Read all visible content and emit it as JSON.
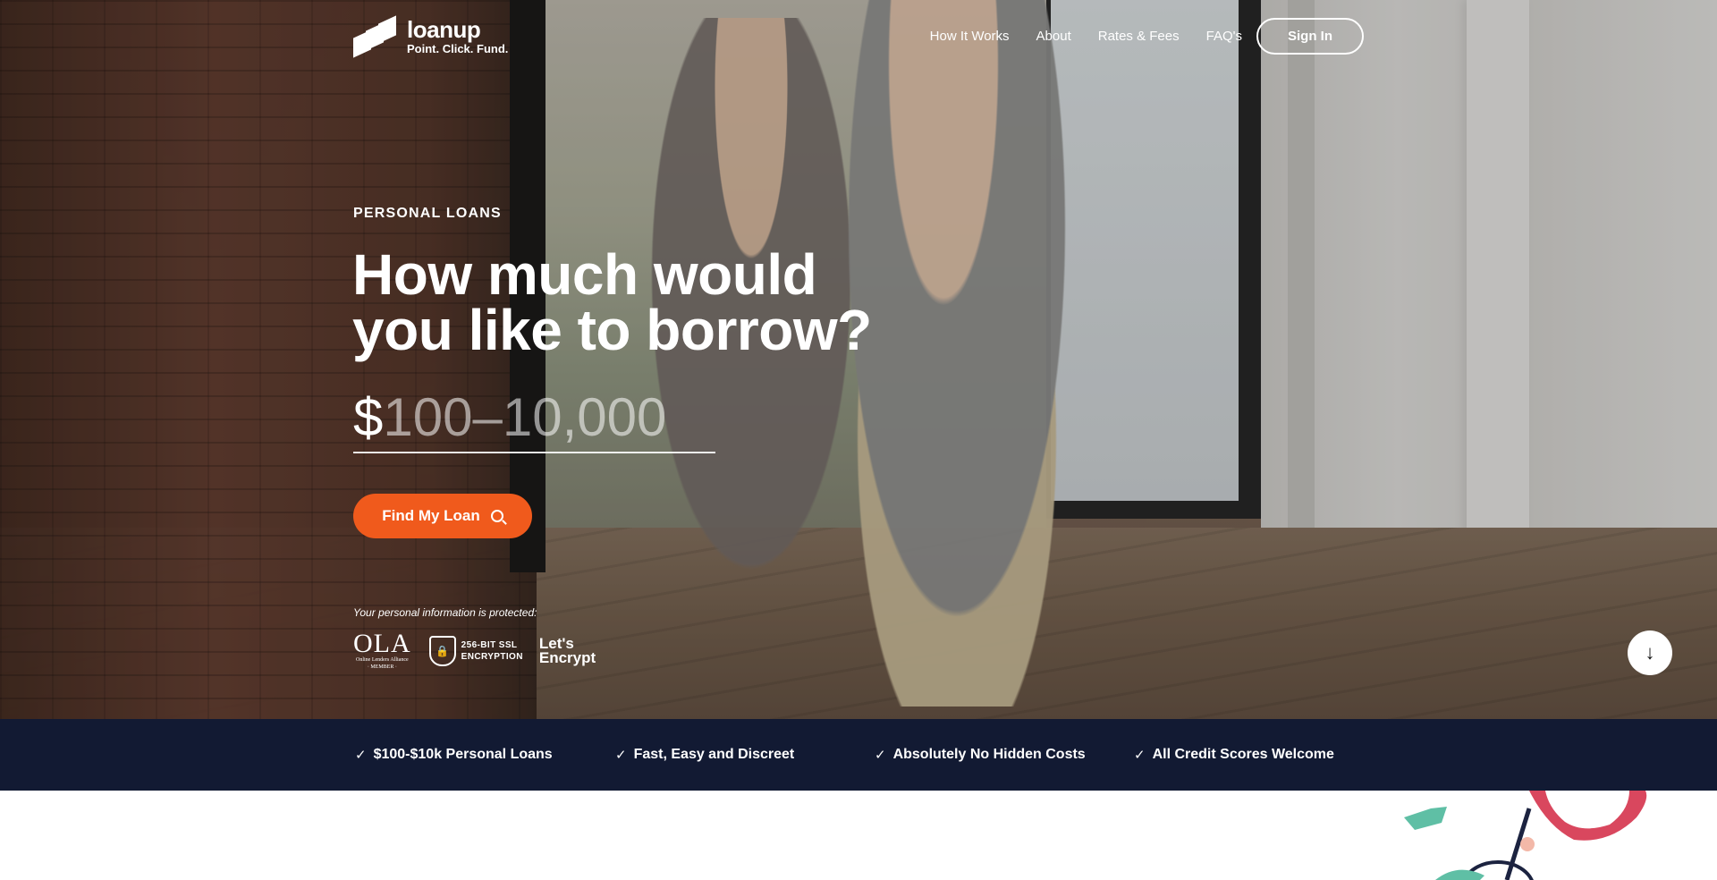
{
  "brand": {
    "name": "loanup",
    "tagline": "Point. Click. Fund."
  },
  "nav": {
    "links": [
      "How It Works",
      "About",
      "Rates & Fees",
      "FAQ's"
    ],
    "signin_label": "Sign In"
  },
  "hero": {
    "eyebrow": "PERSONAL LOANS",
    "headline_line1": "How much would",
    "headline_line2": "you like to borrow?",
    "amount_prefix": "$",
    "amount_placeholder": "100–10,000",
    "cta_label": "Find My Loan",
    "protected_text": "Your personal information is protected:"
  },
  "badges": {
    "ola_big": "OLA",
    "ola_small_1": "Online Lenders Alliance",
    "ola_small_2": "· MEMBER ·",
    "ssl_line1": "256-BIT SSL",
    "ssl_line2": "ENCRYPTION",
    "le_line1": "Let's",
    "le_line2": "Encrypt"
  },
  "features": [
    "$100-$10k Personal Loans",
    "Fast, Easy and Discreet",
    "Absolutely No Hidden Costs",
    "All Credit Scores Welcome"
  ],
  "colors": {
    "accent": "#f05a1c",
    "feature_bar": "#121a33"
  }
}
